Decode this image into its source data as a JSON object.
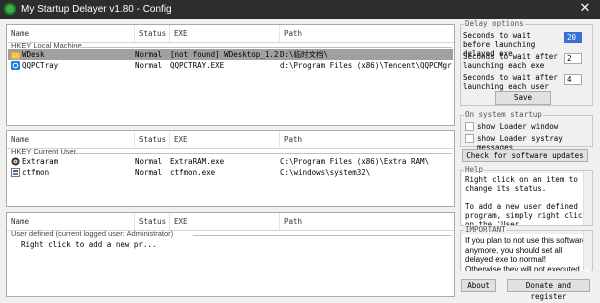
{
  "window": {
    "title": "My Startup Delayer v1.80 - Config",
    "close_glyph": "✕"
  },
  "columns": {
    "name": "Name",
    "status": "Status",
    "exe": "EXE",
    "path": "Path"
  },
  "panels": {
    "local_machine": {
      "group": "HKEY Local Machine",
      "rows": [
        {
          "icon": "folder-icon",
          "name": "WDesk",
          "status": "Normal",
          "exe": "[not found] WDesktop_1.2.exe",
          "path": "D:\\临时文档\\"
        },
        {
          "icon": "qq-icon",
          "name": "QQPCTray",
          "status": "Normal",
          "exe": "QQPCTRAY.EXE",
          "path": "d:\\Program Files (x86)\\Tencent\\QQPCMgr\\11..."
        }
      ]
    },
    "current_user": {
      "group": "HKEY Current User",
      "rows": [
        {
          "icon": "extraram-icon",
          "name": "Extraram",
          "status": "Normal",
          "exe": "ExtraRAM.exe",
          "path": "C:\\Program Files (x86)\\Extra RAM\\"
        },
        {
          "icon": "ctfmon-icon",
          "name": "ctfmon",
          "status": "Normal",
          "exe": "ctfmon.exe",
          "path": "C:\\windows\\system32\\"
        }
      ]
    },
    "user_defined": {
      "group": "User defined (current logged user: Administrator)",
      "hint": "Right click to add a new pr..."
    }
  },
  "delay_options": {
    "caption": "Delay options",
    "before_label": "Seconds to wait before launching delayed exe",
    "before_value": "20",
    "after_each_label": "Seconds to wait after launching each exe",
    "after_each_value": "2",
    "after_user_label": "Seconds to wait after launching each user",
    "after_user_value": "4",
    "save": "Save"
  },
  "system_startup": {
    "caption": "On system startup",
    "show_loader_window": "show Loader window",
    "show_loader_systray": "show Loader systray messages",
    "check_updates": "Check for software updates"
  },
  "help": {
    "caption": "Help",
    "text": "Right click on an item to change its status.\n\nTo add a new user defined program, simply right click on the 'User"
  },
  "important": {
    "caption": "IMPORTANT",
    "text": "If you plan to not use this software anymore, you should set all delayed exe to normal!\nOtherwise they will not executed by"
  },
  "footer": {
    "about": "About",
    "donate": "Donate and register"
  },
  "colors": {
    "titlebar": "#2d2d2d",
    "selected_row": "#a0a0a0",
    "spinner_selected": "#3b6fd4"
  }
}
